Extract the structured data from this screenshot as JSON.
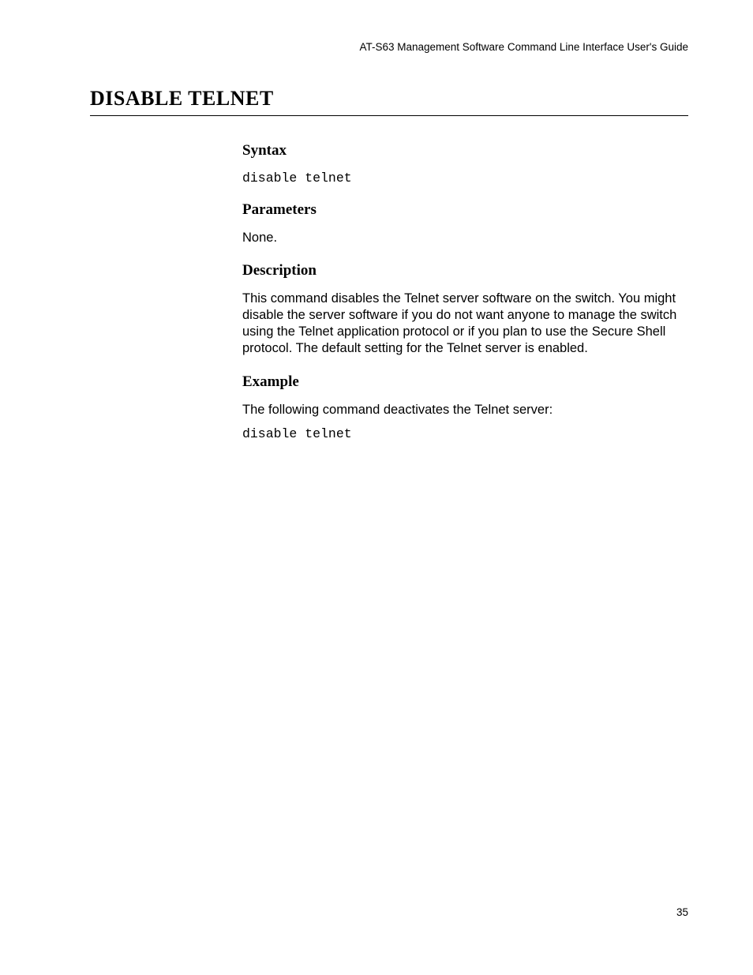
{
  "header": {
    "running_title": "AT-S63 Management Software Command Line Interface User's Guide"
  },
  "title": "DISABLE TELNET",
  "sections": {
    "syntax": {
      "heading": "Syntax",
      "code": "disable telnet"
    },
    "parameters": {
      "heading": "Parameters",
      "text": "None."
    },
    "description": {
      "heading": "Description",
      "text": "This command disables the Telnet server software on the switch. You might disable the server software if you do not want anyone to manage the switch using the Telnet application protocol or if you plan to use the Secure Shell protocol. The default setting for the Telnet server is enabled."
    },
    "example": {
      "heading": "Example",
      "intro": "The following command deactivates the Telnet server:",
      "code": "disable telnet"
    }
  },
  "page_number": "35"
}
